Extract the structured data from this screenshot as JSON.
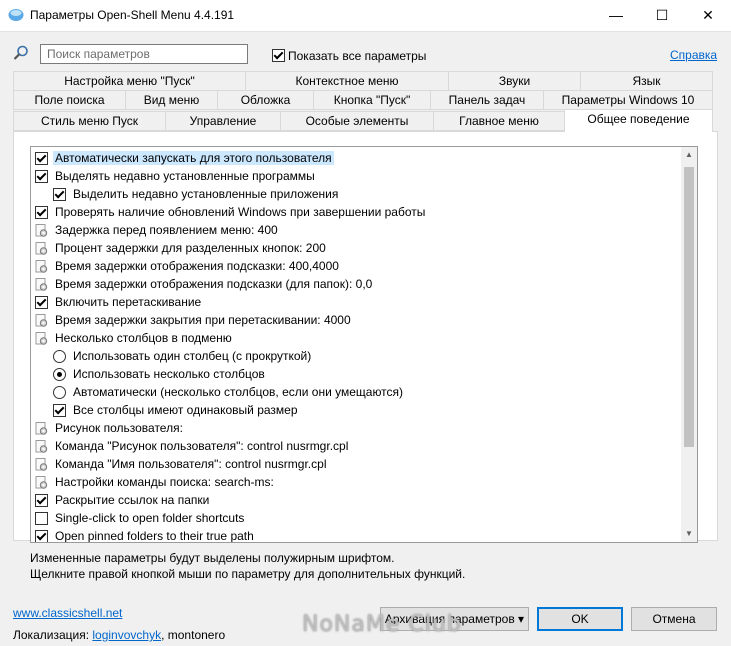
{
  "window": {
    "title": "Параметры Open-Shell Menu 4.4.191",
    "minimize": "—",
    "maximize": "☐",
    "close": "✕"
  },
  "search": {
    "placeholder": "Поиск параметров",
    "show_all_label": "Показать все параметры",
    "show_all_checked": true,
    "help_link": "Справка"
  },
  "tabs": {
    "row1": [
      "Настройка меню \"Пуск\"",
      "Контекстное меню",
      "Звуки",
      "Язык"
    ],
    "row2": [
      "Поле поиска",
      "Вид меню",
      "Обложка",
      "Кнопка \"Пуск\"",
      "Панель задач",
      "Параметры Windows 10"
    ],
    "row3": [
      "Стиль меню Пуск",
      "Управление",
      "Особые элементы",
      "Главное меню",
      "Общее поведение"
    ],
    "active": "Общее поведение"
  },
  "settings": [
    {
      "kind": "checkbox",
      "checked": true,
      "indent": 0,
      "text": "Автоматически запускать для этого пользователя",
      "selected": true
    },
    {
      "kind": "checkbox",
      "checked": true,
      "indent": 0,
      "text": "Выделять недавно установленные программы"
    },
    {
      "kind": "checkbox",
      "checked": true,
      "indent": 1,
      "text": "Выделить недавно установленные приложения"
    },
    {
      "kind": "checkbox",
      "checked": true,
      "indent": 0,
      "text": "Проверять наличие обновлений Windows при завершении работы"
    },
    {
      "kind": "gear",
      "indent": 0,
      "text": "Задержка перед появлением меню: 400"
    },
    {
      "kind": "gear",
      "indent": 0,
      "text": "Процент задержки для разделенных кнопок: 200"
    },
    {
      "kind": "gear",
      "indent": 0,
      "text": "Время задержки отображения подсказки: 400,4000"
    },
    {
      "kind": "gear",
      "indent": 0,
      "text": "Время задержки отображения подсказки (для папок): 0,0"
    },
    {
      "kind": "checkbox",
      "checked": true,
      "indent": 0,
      "text": "Включить перетаскивание"
    },
    {
      "kind": "gear",
      "indent": 0,
      "text": "Время задержки закрытия при перетаскивании: 4000"
    },
    {
      "kind": "gear",
      "indent": 0,
      "text": "Несколько столбцов в подменю"
    },
    {
      "kind": "radio",
      "checked": false,
      "indent": 1,
      "text": "Использовать один столбец (с прокруткой)"
    },
    {
      "kind": "radio",
      "checked": true,
      "indent": 1,
      "text": "Использовать несколько столбцов"
    },
    {
      "kind": "radio",
      "checked": false,
      "indent": 1,
      "text": "Автоматически (несколько столбцов, если они умещаются)"
    },
    {
      "kind": "checkbox",
      "checked": true,
      "indent": 1,
      "text": "Все столбцы имеют одинаковый размер"
    },
    {
      "kind": "gear",
      "indent": 0,
      "text": "Рисунок пользователя:"
    },
    {
      "kind": "gear",
      "indent": 0,
      "text": "Команда \"Рисунок пользователя\": control nusrmgr.cpl"
    },
    {
      "kind": "gear",
      "indent": 0,
      "text": "Команда \"Имя пользователя\": control nusrmgr.cpl"
    },
    {
      "kind": "gear",
      "indent": 0,
      "text": "Настройки команды поиска: search-ms:"
    },
    {
      "kind": "checkbox",
      "checked": true,
      "indent": 0,
      "text": "Раскрытие ссылок на папки"
    },
    {
      "kind": "checkbox",
      "checked": false,
      "indent": 0,
      "text": "Single-click to open folder shortcuts"
    },
    {
      "kind": "checkbox",
      "checked": true,
      "indent": 0,
      "text": "Open pinned folders to their true path"
    }
  ],
  "notes": {
    "line1": "Измененные параметры будут выделены полужирным шрифтом.",
    "line2": "Щелкните правой кнопкой мыши по параметру для дополнительных функций."
  },
  "footer": {
    "website": "www.classicshell.net",
    "localization_label": "Локализация:",
    "localization_author1": "loginvovchyk",
    "localization_sep": ",",
    "localization_author2": "montonero",
    "activation_button": "Архивация параметров ▾",
    "ok_button": "OK",
    "cancel_button": "Отмена",
    "watermark": "NoNaMe Club"
  }
}
